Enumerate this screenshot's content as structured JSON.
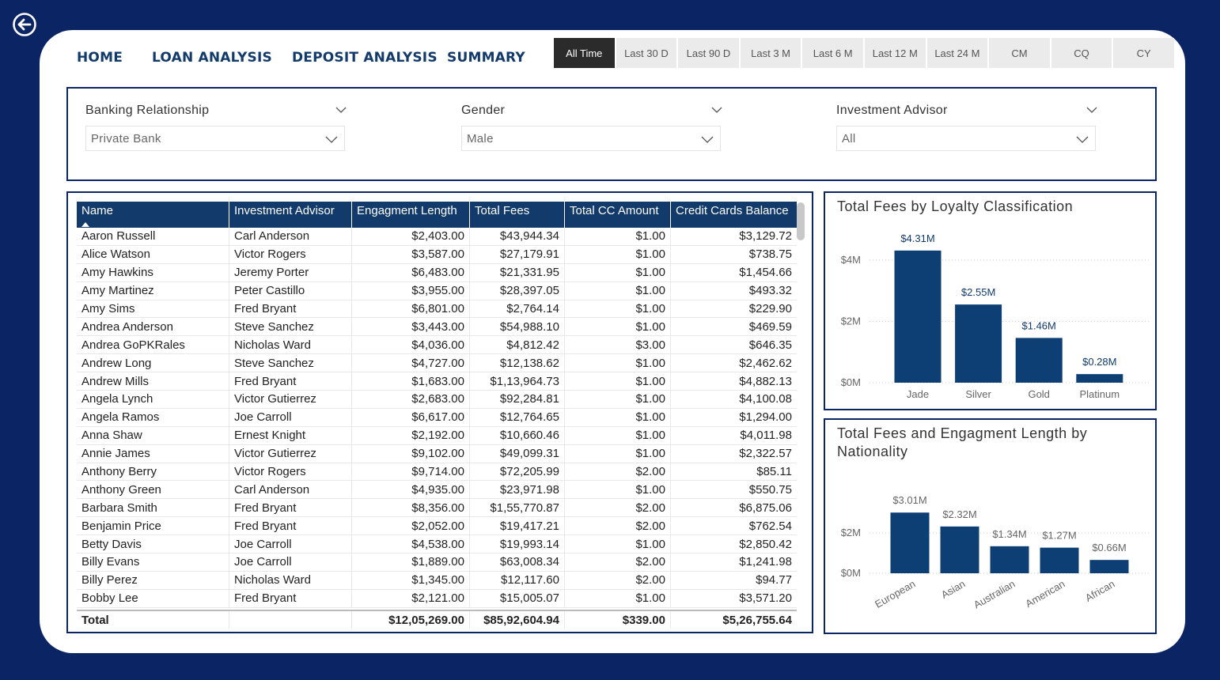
{
  "nav": {
    "back_icon": "back-arrow-circle-icon",
    "items": [
      "HOME",
      "LOAN ANALYSIS",
      "DEPOSIT ANALYSIS",
      "SUMMARY"
    ]
  },
  "periods": [
    "All Time",
    "Last 30 D",
    "Last 90 D",
    "Last 3 M",
    "Last 6 M",
    "Last 12 M",
    "Last 24 M",
    "CM",
    "CQ",
    "CY"
  ],
  "active_period": "All Time",
  "filters": [
    {
      "label": "Banking Relationship",
      "value": "Private Bank"
    },
    {
      "label": "Gender",
      "value": "Male"
    },
    {
      "label": "Investment Advisor",
      "value": "All"
    }
  ],
  "table": {
    "columns": [
      "Name",
      "Investment Advisor",
      "Engagment Length",
      "Total Fees",
      "Total CC Amount",
      "Credit Cards Balance"
    ],
    "rows": [
      [
        "Aaron Russell",
        "Carl Anderson",
        "$2,403.00",
        "$43,944.34",
        "$1.00",
        "$3,129.72"
      ],
      [
        "Alice Watson",
        "Victor Rogers",
        "$3,587.00",
        "$27,179.91",
        "$1.00",
        "$738.75"
      ],
      [
        "Amy Hawkins",
        "Jeremy Porter",
        "$6,483.00",
        "$21,331.95",
        "$1.00",
        "$1,454.66"
      ],
      [
        "Amy Martinez",
        "Peter Castillo",
        "$3,955.00",
        "$28,397.05",
        "$1.00",
        "$493.32"
      ],
      [
        "Amy Sims",
        "Fred Bryant",
        "$6,801.00",
        "$2,764.14",
        "$1.00",
        "$229.90"
      ],
      [
        "Andrea Anderson",
        "Steve Sanchez",
        "$3,443.00",
        "$54,988.10",
        "$1.00",
        "$469.59"
      ],
      [
        "Andrea GoPKRales",
        "Nicholas Ward",
        "$4,036.00",
        "$4,812.42",
        "$3.00",
        "$646.35"
      ],
      [
        "Andrew Long",
        "Steve Sanchez",
        "$4,727.00",
        "$12,138.62",
        "$1.00",
        "$2,462.62"
      ],
      [
        "Andrew Mills",
        "Fred Bryant",
        "$1,683.00",
        "$1,13,964.73",
        "$1.00",
        "$4,882.13"
      ],
      [
        "Angela Lynch",
        "Victor Gutierrez",
        "$2,683.00",
        "$92,284.81",
        "$1.00",
        "$4,100.08"
      ],
      [
        "Angela Ramos",
        "Joe Carroll",
        "$6,617.00",
        "$12,764.65",
        "$1.00",
        "$1,294.00"
      ],
      [
        "Anna Shaw",
        "Ernest Knight",
        "$2,192.00",
        "$10,660.46",
        "$1.00",
        "$4,011.98"
      ],
      [
        "Annie James",
        "Victor Gutierrez",
        "$9,102.00",
        "$49,099.31",
        "$1.00",
        "$2,322.57"
      ],
      [
        "Anthony Berry",
        "Victor Rogers",
        "$9,714.00",
        "$72,205.99",
        "$2.00",
        "$85.11"
      ],
      [
        "Anthony Green",
        "Carl Anderson",
        "$4,935.00",
        "$23,971.98",
        "$1.00",
        "$550.75"
      ],
      [
        "Barbara Smith",
        "Fred Bryant",
        "$8,356.00",
        "$1,55,770.87",
        "$2.00",
        "$6,875.06"
      ],
      [
        "Benjamin Price",
        "Fred Bryant",
        "$2,052.00",
        "$19,417.21",
        "$2.00",
        "$762.54"
      ],
      [
        "Betty Davis",
        "Joe Carroll",
        "$4,538.00",
        "$19,993.14",
        "$1.00",
        "$2,850.42"
      ],
      [
        "Billy Evans",
        "Joe Carroll",
        "$1,889.00",
        "$63,008.34",
        "$2.00",
        "$1,241.98"
      ],
      [
        "Billy Perez",
        "Nicholas Ward",
        "$1,345.00",
        "$12,117.60",
        "$2.00",
        "$94.77"
      ],
      [
        "Bobby Lee",
        "Fred Bryant",
        "$2,121.00",
        "$15,005.07",
        "$1.00",
        "$3,571.20"
      ]
    ],
    "total": [
      "Total",
      "",
      "$12,05,269.00",
      "$85,92,604.94",
      "$339.00",
      "$5,26,755.64"
    ]
  },
  "chart_data": [
    {
      "type": "bar",
      "title": "Total Fees by Loyalty Classification",
      "categories": [
        "Jade",
        "Silver",
        "Gold",
        "Platinum"
      ],
      "values": [
        4.31,
        2.55,
        1.46,
        0.28
      ],
      "value_labels": [
        "$4.31M",
        "$2.55M",
        "$1.46M",
        "$0.28M"
      ],
      "yticks": [
        "$0M",
        "$2M",
        "$4M"
      ],
      "ylim": [
        0,
        4.5
      ],
      "bar_color": "#0e3f74",
      "label_color": "#123a6b",
      "grid": true
    },
    {
      "type": "bar",
      "title": "Total Fees and Engagment Length by Nationality",
      "categories": [
        "European",
        "Asian",
        "Australian",
        "American",
        "African"
      ],
      "values": [
        3.01,
        2.32,
        1.34,
        1.27,
        0.66
      ],
      "value_labels": [
        "$3.01M",
        "$2.32M",
        "$1.34M",
        "$1.27M",
        "$0.66M"
      ],
      "yticks": [
        "$0M",
        "$2M"
      ],
      "ylim": [
        0,
        3.4
      ],
      "bar_color": "#0e3f74",
      "label_color": "#666666",
      "grid": true
    }
  ]
}
